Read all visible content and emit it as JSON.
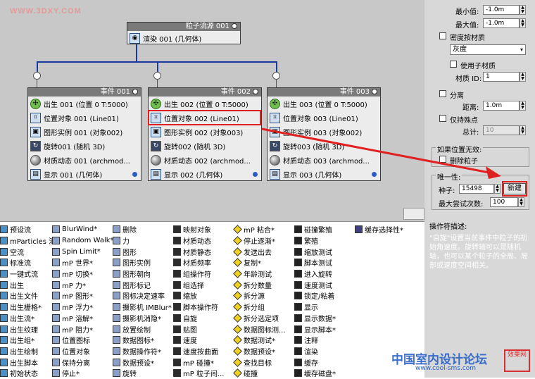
{
  "watermark": "WWW.3DXY.COM",
  "source": {
    "title": "粒子流源 001",
    "item": "渲染 001 (几何体)"
  },
  "events": [
    {
      "title": "事件 001",
      "rows": [
        "出生 001 (位置 0 T:5000)",
        "位置对象 001 (Line01)",
        "图形实例 001 (对象002)",
        "旋转001 (随机 3D)",
        "材质动态 001 (archmod...",
        "显示 001 (几何体)"
      ]
    },
    {
      "title": "事件 002",
      "rows": [
        "出生 002 (位置 0 T:5000)",
        "位置对象 002 (Line01)",
        "图形实例 002 (对象003)",
        "旋转002 (随机 3D)",
        "材质动态 002 (archmod...",
        "显示 002 (几何体)"
      ]
    },
    {
      "title": "事件 003",
      "rows": [
        "出生 003 (位置 0 T:5000)",
        "位置对象 003 (Line01)",
        "图形实例 003 (对象002)",
        "旋转003 (随机 3D)",
        "材质动态 003 (archmod...",
        "显示 003 (几何体)"
      ]
    }
  ],
  "panel": {
    "min_label": "最小值:",
    "min_val": "-1.0m",
    "max_label": "最大值:",
    "max_val": "-1.0m",
    "density_label": "密度按材质",
    "gray": "灰度",
    "use_sub": "使用子材质",
    "mat_id_label": "材质 ID:",
    "mat_id_val": "1",
    "separate": "分离",
    "distance_label": "距离:",
    "distance_val": "1.0m",
    "vertex_only": "仅持殊点",
    "total_label": "总计:",
    "total_val": "10",
    "invalid_group": "如果位置无效:",
    "delete_particle": "删除粒子",
    "unique_group": "唯一性:",
    "seed_label": "种子:",
    "seed_val": "15498",
    "new_button": "新建",
    "max_attempts_label": "最大尝试次数:",
    "max_attempts_val": "100"
  },
  "description": {
    "label": "操作符描述:",
    "text": "\"自旋\"设置当前事件中粒子的初始角速度。旋转轴可以是随机轴，也可以某个粒子的全局、局部或速度空间相关。"
  },
  "depot": [
    [
      "预设流",
      "mParticles 流*",
      "空流",
      "标准流",
      "一键式流",
      "出生",
      "出生文件",
      "出生栅格*",
      "出生流*",
      "出生纹理",
      "出生组*",
      "出生绘制",
      "出生脚本",
      "初始状态"
    ],
    [
      "BlurWind*",
      "Random Walk*",
      "Spin Limit*",
      "mP 世界*",
      "mP 切换*",
      "mP 力*",
      "mP 图形*",
      "mP 浮力*",
      "mP 溶解*",
      "mP 阻力*",
      "位置图标",
      "位置对象",
      "保持分离",
      "停止*"
    ],
    [
      "删除",
      "力",
      "图形",
      "图形实例",
      "图形朝向",
      "图形标记",
      "图标决定速率",
      "摄影机 IMBlur*",
      "摄影机消隐*",
      "放置绘制",
      "数据图标*",
      "数据操作符*",
      "数据预设*",
      "旋转"
    ],
    [
      "映射对象",
      "材质动态",
      "材质静态",
      "材质频率",
      "组操作符",
      "组选择",
      "缩放",
      "脚本操作符",
      "自旋",
      "贴图",
      "速度",
      "速度按曲面",
      "mP 碰撞*",
      "mP 粒子间..."
    ],
    [
      "mP 粘合*",
      "停止逐渐*",
      "发送出去",
      "复制*",
      "年龄测试",
      "拆分数量",
      "拆分源",
      "拆分组",
      "拆分选定项",
      "数据图标测...",
      "数据测试*",
      "数据预设*",
      "查找目标",
      "碰撞"
    ],
    [
      "碰撞繁殖",
      "繁殖",
      "缩放测试",
      "脚本测试",
      "进入旋转",
      "速度测试",
      "锁定/粘着",
      "显示",
      "显示数据*",
      "显示脚本*",
      "注释",
      "渲染",
      "缓存",
      "缓存磁盘*"
    ],
    [
      "缓存选择性*"
    ]
  ],
  "logo": "中国室内设计论坛",
  "logo_sub": "www.cool-sms.com",
  "stamp": "效果网"
}
